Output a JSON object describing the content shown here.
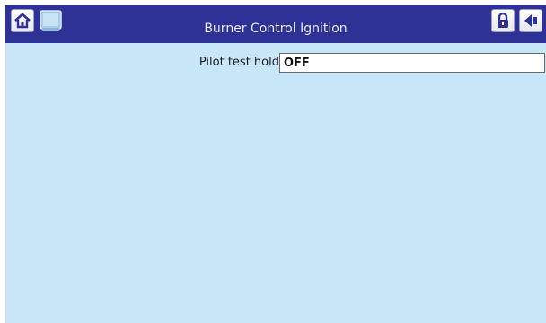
{
  "header": {
    "title": "Burner Control Ignition",
    "icons": [
      "home-icon",
      "screen-icon",
      "lock-icon",
      "back-arrow-icon"
    ]
  },
  "parameters": [
    {
      "label": "Pilot test hold",
      "value": "OFF"
    }
  ],
  "colors": {
    "header_bg": "#2e3196",
    "screen_bg": "#c7e7f8",
    "title_text": "#e8ecf8"
  }
}
